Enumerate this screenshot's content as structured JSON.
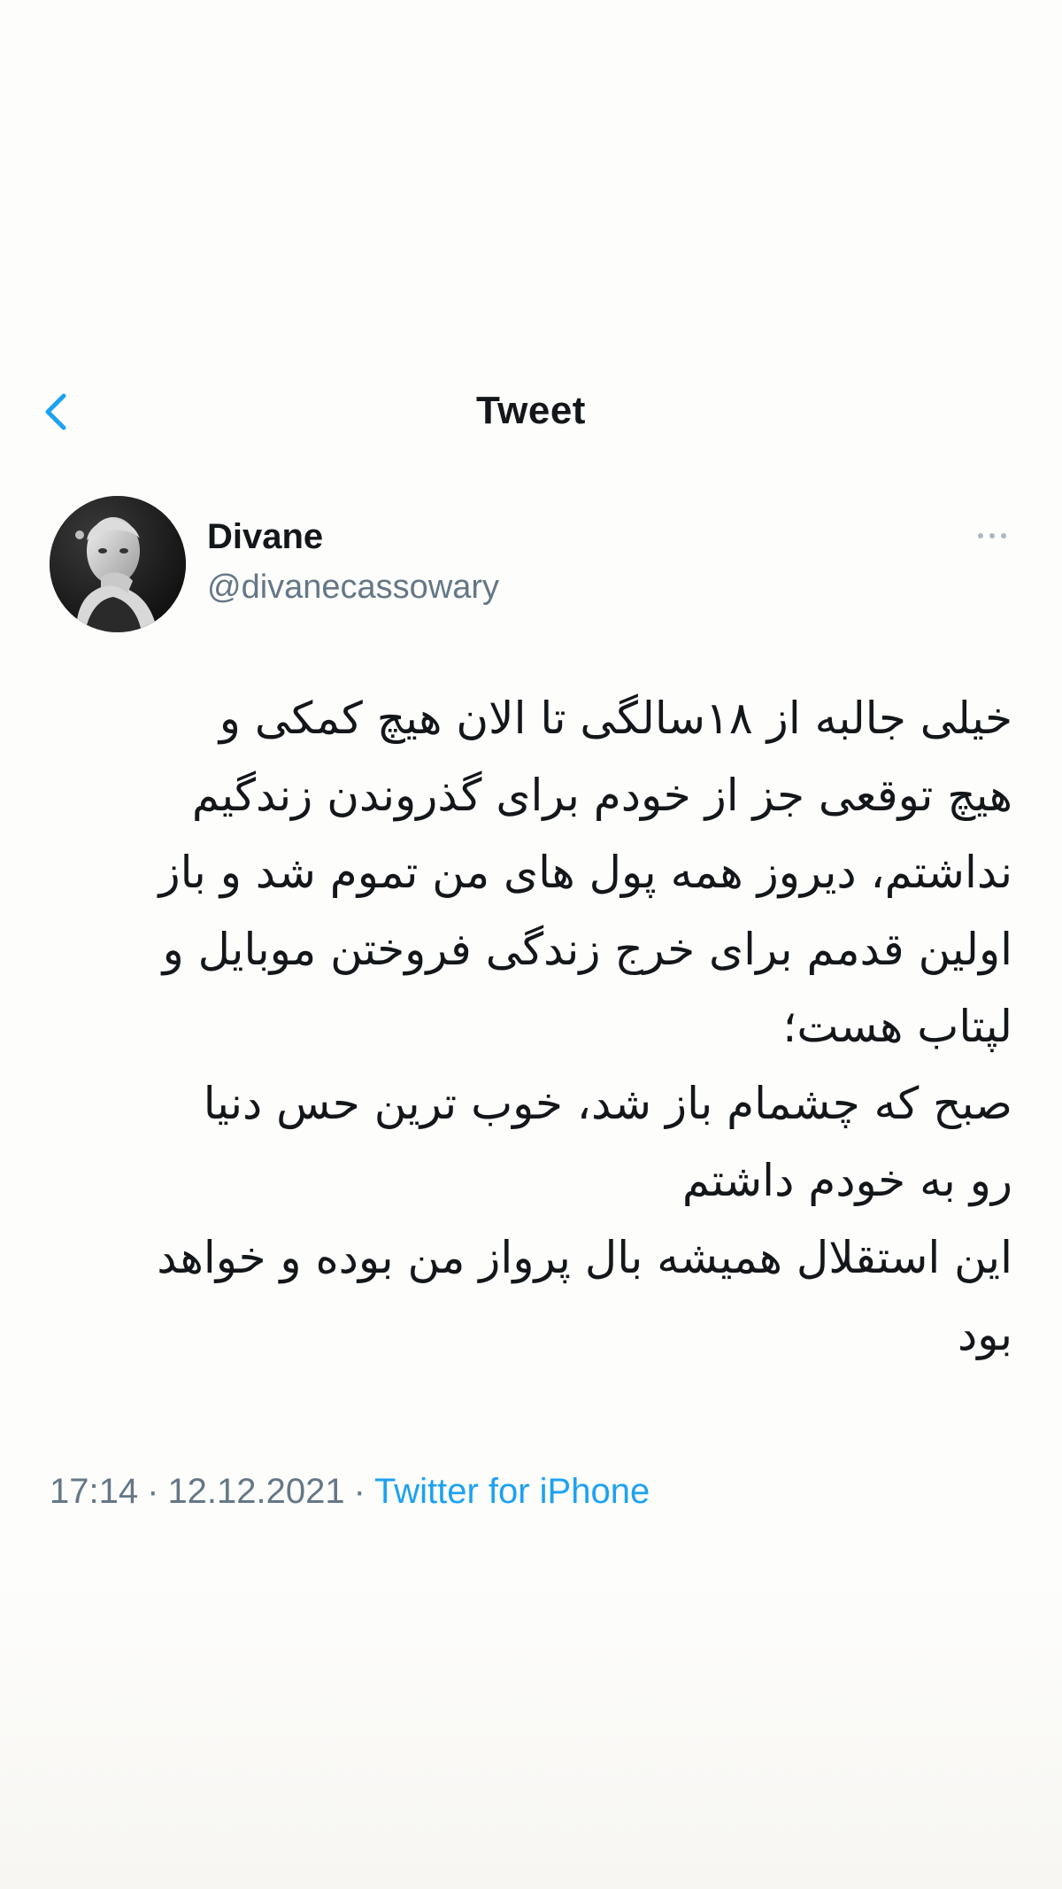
{
  "header": {
    "title": "Tweet",
    "back_icon": "chevron-left-icon",
    "accent_color": "#1da1f2"
  },
  "author": {
    "display_name": "Divane",
    "handle": "@divanecassowary",
    "avatar_icon": "avatar-photo",
    "more_icon": "more-horizontal-icon"
  },
  "tweet": {
    "lines": [
      "خیلی جالبه از ۱۸سالگی تا الان هیچ کمکی و",
      "هیچ توقعی جز از خودم برای گذروندن زندگیم",
      "نداشتم، دیروز همه پول های من تموم شد و باز",
      "اولین قدمم برای خرج زندگی فروختن موبایل و",
      "لپتاب هست؛",
      "صبح که چشمام باز شد، خوب ترین حس دنیا",
      "رو به خودم داشتم",
      "این استقلال همیشه بال پرواز من بوده و خواهد",
      "بود"
    ],
    "time": "17:14",
    "date": "12.12.2021",
    "separator": "·",
    "source": "Twitter for iPhone"
  }
}
